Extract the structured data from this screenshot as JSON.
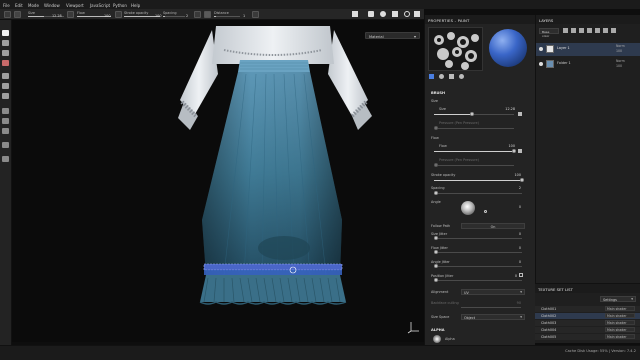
{
  "menu": [
    "File",
    "Edit",
    "Mode",
    "Window",
    "Viewport",
    "JavaScript",
    "Python",
    "Help"
  ],
  "toolbar": {
    "size_label": "Size",
    "size_value": "12.28",
    "flow_label": "Flow",
    "flow_value": "100",
    "stroke_opacity_label": "Stroke opacity",
    "stroke_opacity_value": "100",
    "spacing_label": "Spacing",
    "spacing_value": "2",
    "distance_label": "Distance",
    "distance_value": "1"
  },
  "viewport": {
    "mode_dropdown": "Material"
  },
  "properties": {
    "title": "PROPERTIES - PAINT",
    "brush_section": "BRUSH",
    "size_label": "Size",
    "size_sub": "Size",
    "size_value": "12.28",
    "size_level": 0.48,
    "size_pressure_label": "Pressure (Pen Pressure)",
    "flow_label": "Flow",
    "flow_sub": "Flow",
    "flow_value": "100",
    "flow_level": 1.0,
    "flow_pressure_label": "Pressure (Pen Pressure)",
    "stroke_opacity_label": "Stroke opacity",
    "stroke_opacity_value": "100",
    "stroke_opacity_level": 1.0,
    "spacing_label": "Spacing",
    "spacing_value": "2",
    "spacing_level": 0.02,
    "angle_label": "Angle",
    "angle_value": "0",
    "follow_path_label": "Follow Path",
    "follow_path_value": "On",
    "size_jitter_label": "Size Jitter",
    "size_jitter_value": "0",
    "flow_jitter_label": "Flow Jitter",
    "flow_jitter_value": "0",
    "angle_jitter_label": "Angle Jitter",
    "angle_jitter_value": "0",
    "position_jitter_label": "Position Jitter",
    "position_jitter_value": "0",
    "alignment_label": "Alignment",
    "alignment_value": "UV",
    "backface_culling_label": "Backface culling",
    "backface_culling_value": "90",
    "size_space_label": "Size Space",
    "size_space_value": "Object",
    "alpha_section": "ALPHA",
    "alpha_name": "Alpha"
  },
  "layers": {
    "title": "LAYERS",
    "blend_mode": "Base color",
    "rows": [
      {
        "name": "Layer 1",
        "blend": "Norm",
        "opacity": "100"
      },
      {
        "name": "Folder 1",
        "blend": "Norm",
        "opacity": "100"
      }
    ]
  },
  "texture_set_list": {
    "title": "TEXTURE SET LIST",
    "settings_label": "Settings",
    "items": [
      {
        "name": "Cloth001",
        "shader": "Main shader"
      },
      {
        "name": "Cloth002",
        "shader": "Main shader"
      },
      {
        "name": "Cloth003",
        "shader": "Main shader"
      },
      {
        "name": "Cloth004",
        "shader": "Main shader"
      },
      {
        "name": "Cloth005",
        "shader": "Main shader"
      }
    ]
  },
  "status": {
    "text": "Cache Disk Usage: 55% | Version: 7.4.2"
  },
  "colors": {
    "accent_blue": "#3a66c8",
    "skirt": "#3f7a95",
    "blouse": "#e6eaee"
  }
}
